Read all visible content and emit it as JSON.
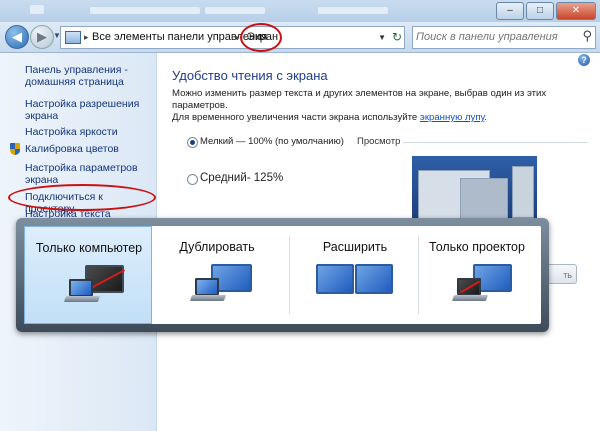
{
  "window": {
    "close_symbol": "✕",
    "minimize_symbol": "–",
    "maximize_symbol": "□"
  },
  "addressbar": {
    "segment1": "Все элементы панели управления",
    "segment2": "Экран",
    "separator": "▸"
  },
  "search": {
    "placeholder": "Поиск в панели управления"
  },
  "sidebar": {
    "home": "Панель управления - домашняя страница",
    "links": [
      "Настройка разрешения экрана",
      "Настройка яркости",
      "Калибровка цветов",
      "Настройка параметров экрана",
      "Подключиться к проектору",
      "Настройка текста ClearType"
    ]
  },
  "main": {
    "heading": "Удобство чтения с экрана",
    "description_line1": "Можно изменить размер текста и других элементов на экране, выбрав один из этих параметров.",
    "description_line2_prefix": "Для временного увеличения части экрана используйте",
    "description_link": "экранную лупу",
    "description_suffix": ".",
    "options": [
      {
        "label": "Мелкий — 100% (по умолчанию)",
        "selected": true
      },
      {
        "label": "Средний- 125%",
        "selected": false
      }
    ],
    "preview_label": "Просмотр"
  },
  "projector": {
    "items": [
      {
        "label": "Только компьютер",
        "selected": true
      },
      {
        "label": "Дублировать",
        "selected": false
      },
      {
        "label": "Расширить",
        "selected": false
      },
      {
        "label": "Только проектор",
        "selected": false
      }
    ]
  },
  "colors": {
    "link": "#15357a",
    "heading": "#1e3e86",
    "annotation": "#c91111",
    "selection": "#c2dff7"
  },
  "icons": [
    "back-arrow-icon",
    "forward-arrow-icon",
    "control-panel-icon",
    "refresh-icon",
    "search-icon",
    "help-icon",
    "shield-icon",
    "laptop-icon",
    "monitor-icon"
  ]
}
